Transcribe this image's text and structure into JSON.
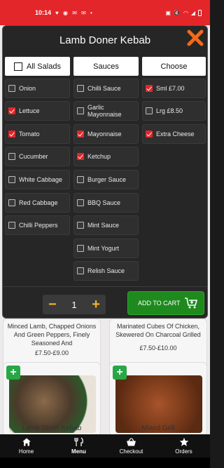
{
  "status_bar": {
    "time": "10:14"
  },
  "modal": {
    "title": "Lamb Doner Kebab",
    "columns": {
      "salads": {
        "header": "All Salads",
        "options": [
          {
            "label": "Onion",
            "checked": false
          },
          {
            "label": "Lettuce",
            "checked": true
          },
          {
            "label": "Tomato",
            "checked": true
          },
          {
            "label": "Cucumber",
            "checked": false
          },
          {
            "label": "White Cabbage",
            "checked": false
          },
          {
            "label": "Red Cabbage",
            "checked": false
          },
          {
            "label": "Chilli Peppers",
            "checked": false
          }
        ]
      },
      "sauces": {
        "header": "Sauces",
        "options": [
          {
            "label": "Chilli Sauce",
            "checked": false
          },
          {
            "label": "Garlic Mayonnaise",
            "checked": false
          },
          {
            "label": "Mayonnaise",
            "checked": true
          },
          {
            "label": "Ketchup",
            "checked": true
          },
          {
            "label": "Burger Sauce",
            "checked": false
          },
          {
            "label": "BBQ Sauce",
            "checked": false
          },
          {
            "label": "Mint Sauce",
            "checked": false
          },
          {
            "label": "Mint Yogurt",
            "checked": false
          },
          {
            "label": "Relish Sauce",
            "checked": false
          }
        ]
      },
      "choose": {
        "header": "Choose",
        "options": [
          {
            "label": "Sml £7.00",
            "checked": true
          },
          {
            "label": "Lrg £8.50",
            "checked": false
          },
          {
            "label": "Extra Cheese",
            "checked": true
          }
        ]
      }
    },
    "quantity": {
      "minus": "−",
      "value": "1",
      "plus": "+"
    },
    "add_to_cart_label": "ADD TO CART"
  },
  "background_cards": [
    {
      "desc": "Minced Lamb, Chapped Onions And Green Peppers, Finely Seasoned And",
      "price": "£7.50-£9.00",
      "name": "Lamb Shish Kebab"
    },
    {
      "desc": "Marinated Cubes Of Chicken, Skewered On Charcoal Grilled",
      "price": "£7.50-£10.00",
      "name": "Mixed Grill"
    }
  ],
  "bottom_nav": [
    {
      "label": "Home",
      "icon": "home-icon",
      "active": false
    },
    {
      "label": "Menu",
      "icon": "cutlery-icon",
      "active": true
    },
    {
      "label": "Checkout",
      "icon": "basket-icon",
      "active": false
    },
    {
      "label": "Orders",
      "icon": "star-icon",
      "active": false
    }
  ],
  "colors": {
    "brand_red": "#e3262a",
    "cart_green": "#1e8a1e",
    "qty_yellow": "#f2b41a",
    "close_orange": "#f26a1b"
  }
}
